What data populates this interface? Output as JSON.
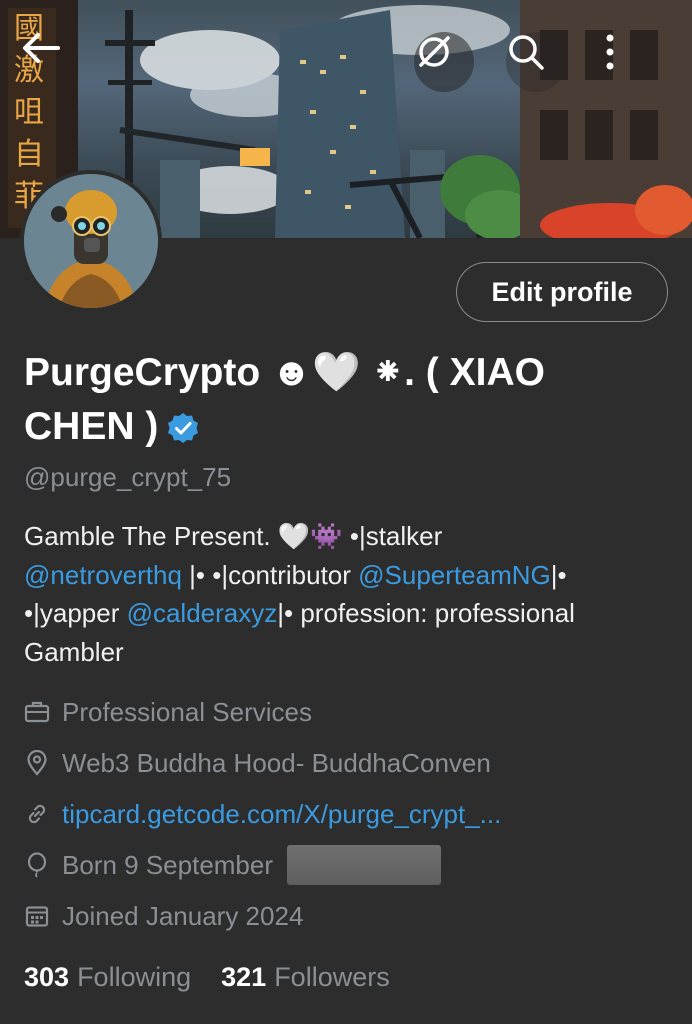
{
  "header": {
    "back_icon": "arrow-left-icon",
    "grok_icon": "grok-icon",
    "search_icon": "search-icon",
    "more_icon": "more-vertical-icon"
  },
  "profile": {
    "edit_button_label": "Edit profile",
    "display_name": "PurgeCrypto ☻🤍 ⁕. ( XIAO CHEN )",
    "handle": "@purge_crypt_75",
    "verified": true
  },
  "bio": {
    "line1_text": "Gamble The Present. 🤍👾 •|stalker",
    "line2_link1": "@netroverthq",
    "line2_text": " |• •|contributor ",
    "line2_link2": "@SuperteamNG",
    "line2_end": "|•",
    "line3_text": "•|yapper ",
    "line3_link": "@calderaxyz",
    "line3_end": "|•  profession: professional",
    "line4_text": "Gambler"
  },
  "meta": {
    "category": "Professional Services",
    "location": "Web3 Buddha Hood- BuddhaConven",
    "website": "tipcard.getcode.com/X/purge_crypt_...",
    "birthday": "Born 9 September",
    "joined": "Joined January 2024"
  },
  "stats": {
    "following_count": "303",
    "following_label": "Following",
    "followers_count": "321",
    "followers_label": "Followers"
  },
  "colors": {
    "background": "#2d2d2d",
    "link": "#3b9be0",
    "muted": "#8b9096",
    "verified": "#3b9be0"
  }
}
